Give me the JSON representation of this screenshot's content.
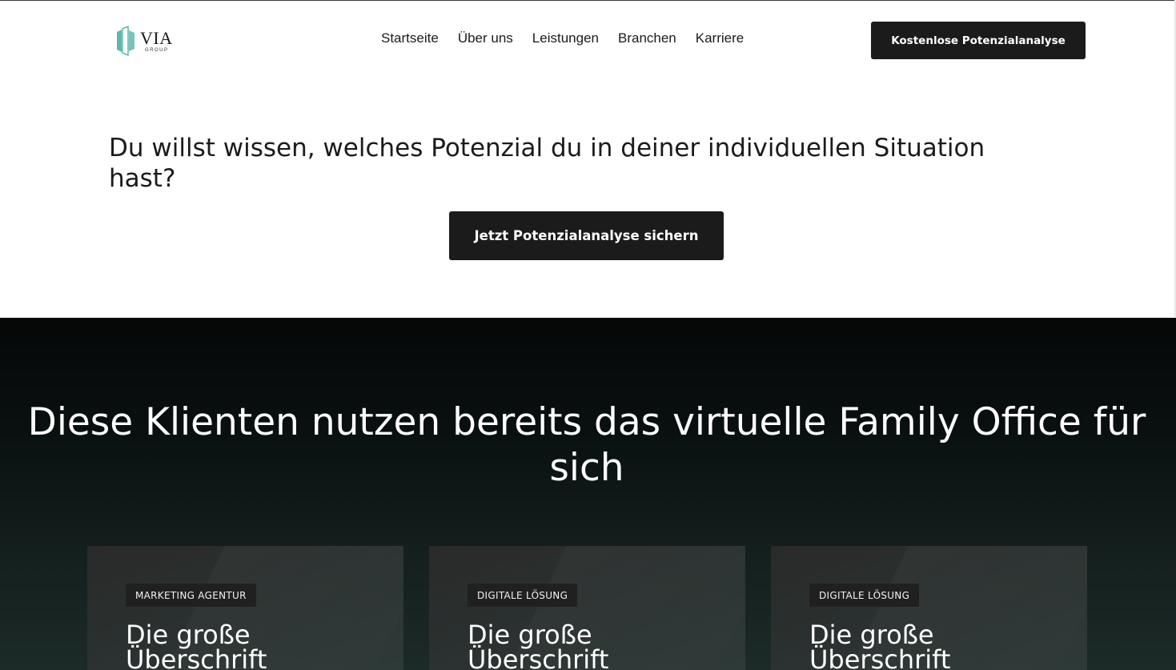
{
  "header": {
    "logo": {
      "main": "VIA",
      "sub": "GROUP"
    },
    "nav": [
      "Startseite",
      "Über uns",
      "Leistungen",
      "Branchen",
      "Karriere"
    ],
    "cta_label": "Kostenlose Potenzialanalyse"
  },
  "hero": {
    "question": "Du willst wissen, welches Potenzial du in deiner individuellen Situation hast?",
    "cta_label": "Jetzt Potenzialanalyse sichern"
  },
  "clients": {
    "title": "Diese Klienten nutzen bereits das virtuelle Family Office für sich",
    "cards": [
      {
        "tag": "MARKETING AGENTUR",
        "heading": "Die große Überschrift"
      },
      {
        "tag": "DIGITALE LÖSUNG",
        "heading": "Die große Überschrift"
      },
      {
        "tag": "DIGITALE LÖSUNG",
        "heading": "Die große Überschrift"
      }
    ]
  },
  "colors": {
    "button_bg": "#1b1b1b",
    "logo_accent": "#5fb7ad",
    "dark_section_top": "#050707",
    "dark_section_bottom": "#1c2a28"
  },
  "icons": [
    "via-group-logo-icon"
  ]
}
